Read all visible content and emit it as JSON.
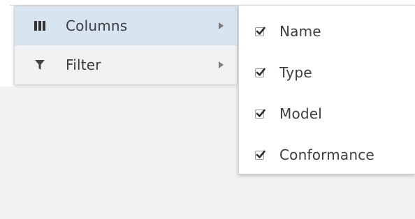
{
  "menu": {
    "items": [
      {
        "label": "Columns",
        "icon": "columns-icon",
        "active": true
      },
      {
        "label": "Filter",
        "icon": "filter-icon",
        "active": false
      }
    ]
  },
  "submenu": {
    "items": [
      {
        "label": "Name",
        "checked": true
      },
      {
        "label": "Type",
        "checked": true
      },
      {
        "label": "Model",
        "checked": true
      },
      {
        "label": "Conformance",
        "checked": true
      }
    ]
  },
  "colors": {
    "active_item_bg": "#d6e5ef",
    "menu_bg": "#f5f5f5",
    "text": "#3d3d3d"
  }
}
